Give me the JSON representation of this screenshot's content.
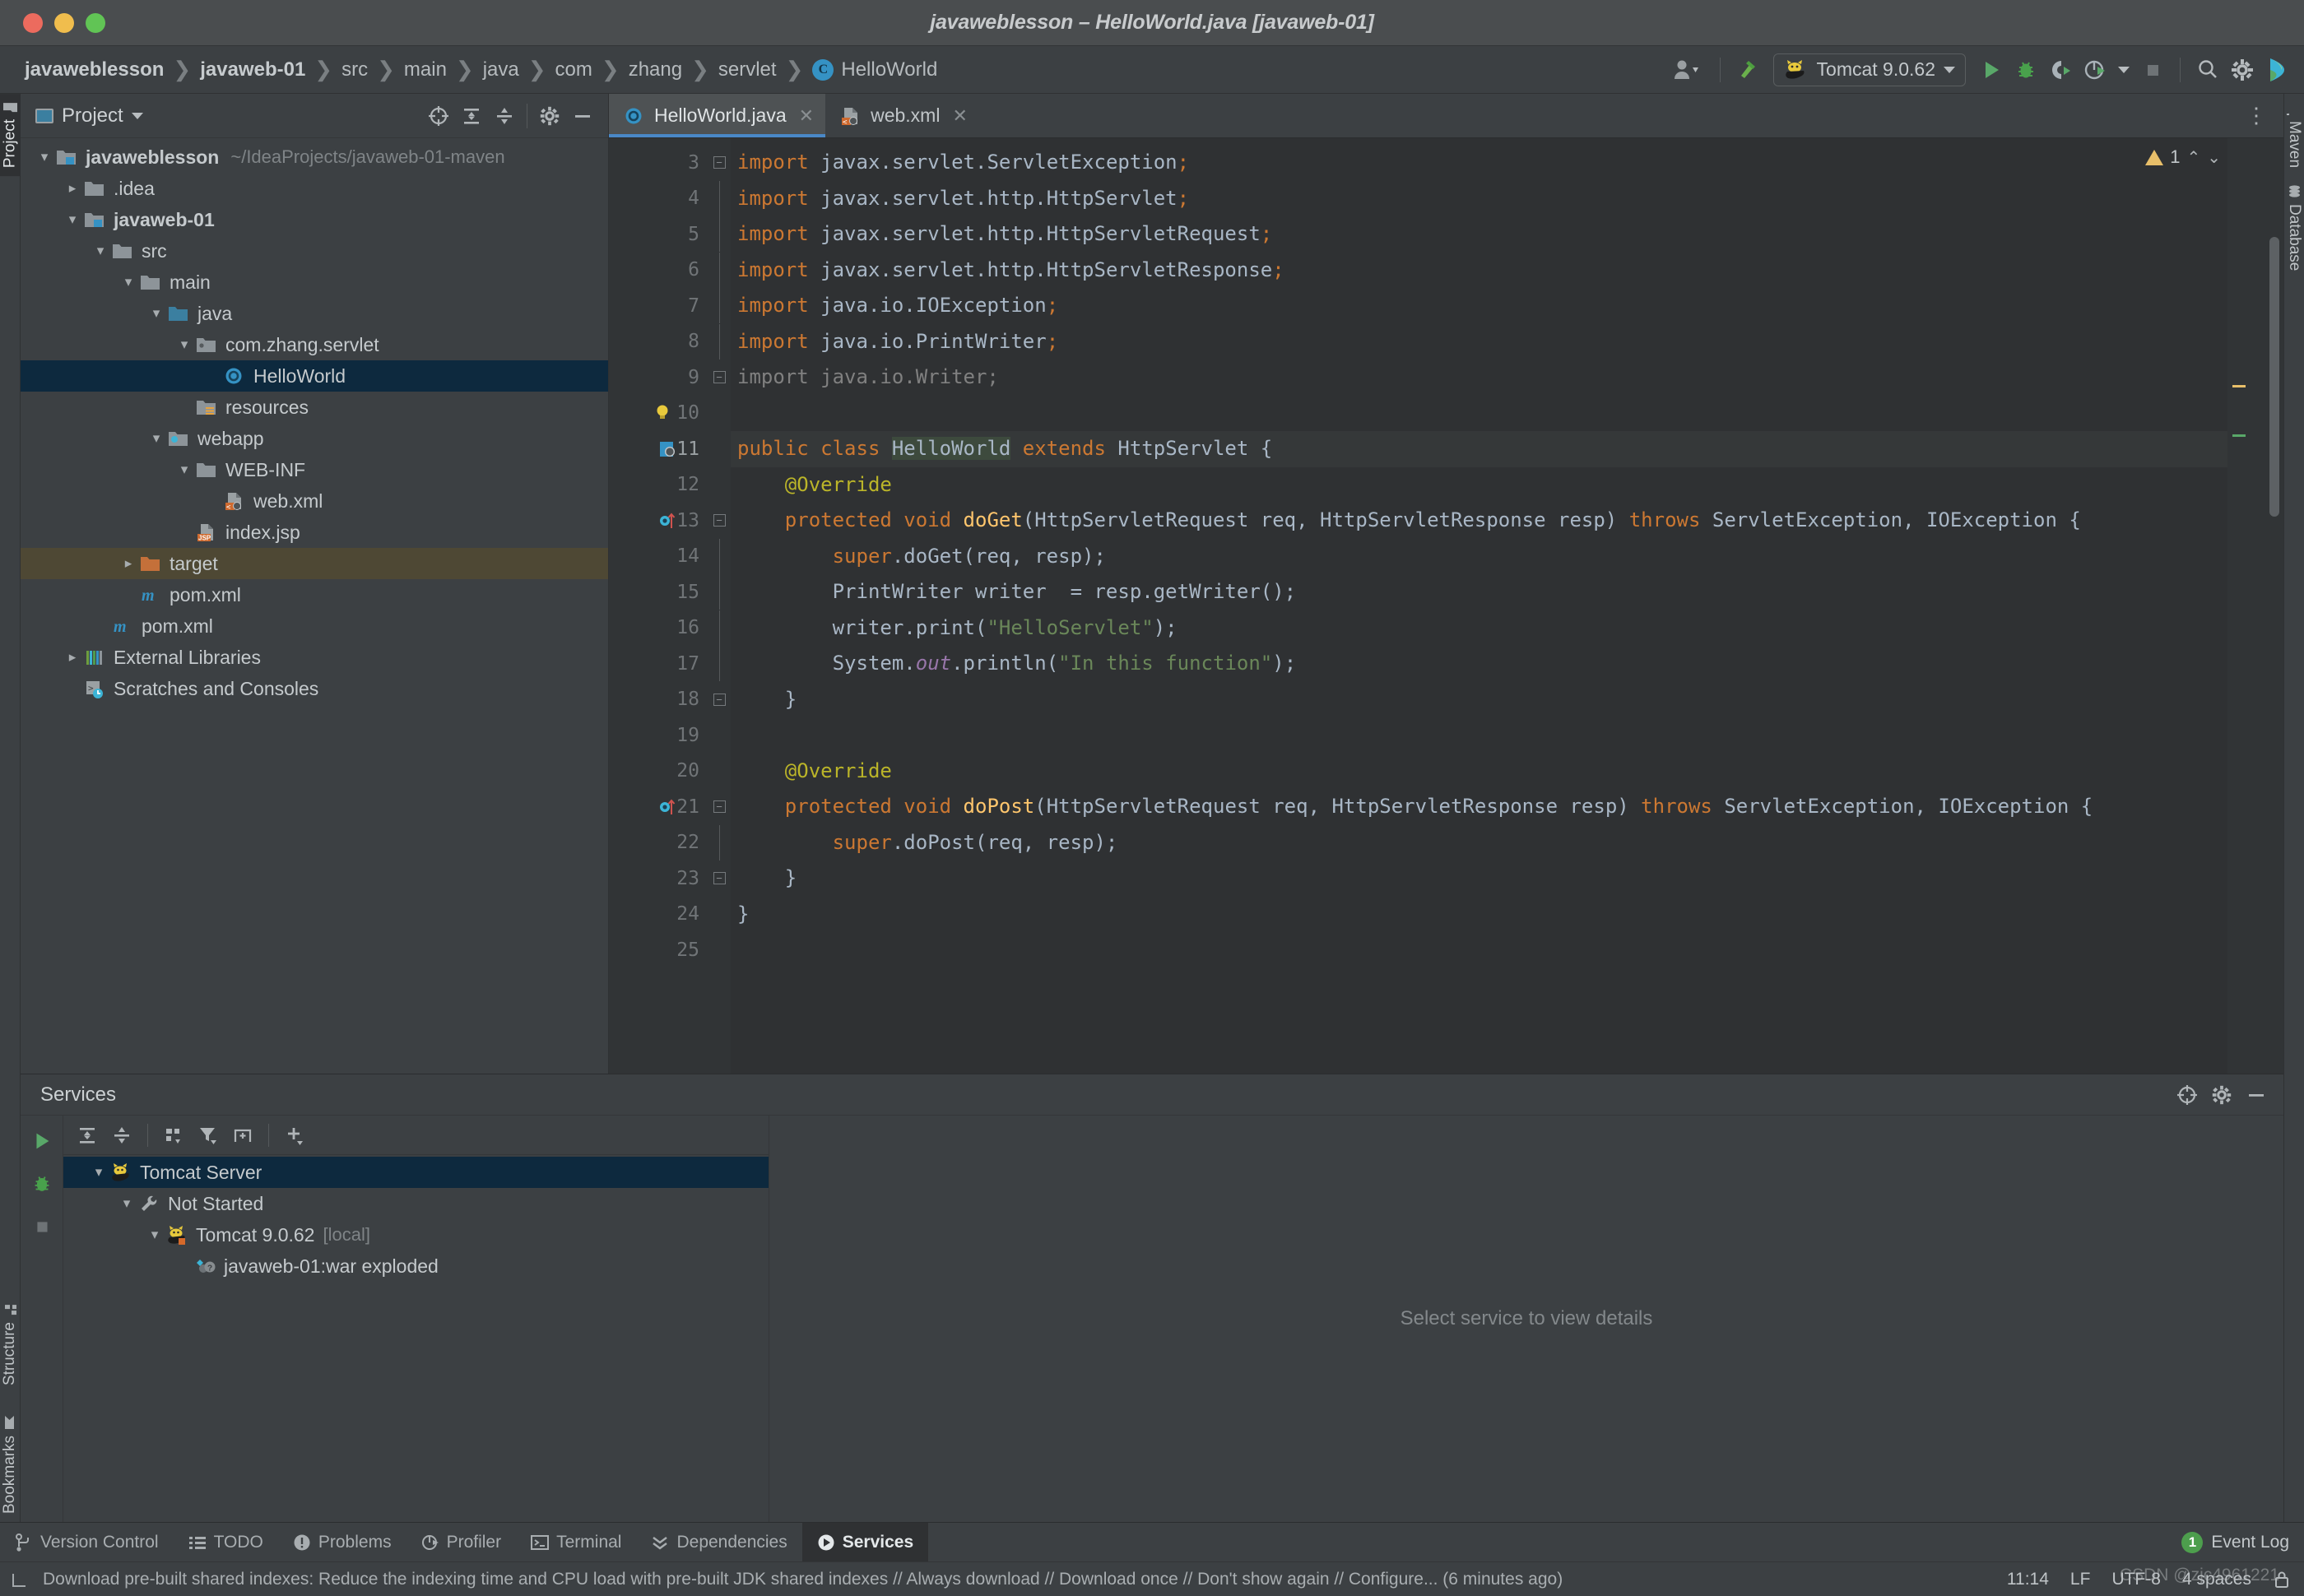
{
  "window": {
    "title": "javaweblesson – HelloWorld.java [javaweb-01]",
    "traffic": [
      "close-button",
      "minimize-button",
      "maximize-button"
    ]
  },
  "breadcrumbs": [
    {
      "label": "javaweblesson",
      "bold": true
    },
    {
      "label": "javaweb-01",
      "bold": true
    },
    {
      "label": "src",
      "bold": false
    },
    {
      "label": "main",
      "bold": false
    },
    {
      "label": "java",
      "bold": false
    },
    {
      "label": "com",
      "bold": false
    },
    {
      "label": "zhang",
      "bold": false
    },
    {
      "label": "servlet",
      "bold": false
    }
  ],
  "breadcrumb_class": {
    "badge": "C",
    "label": "HelloWorld"
  },
  "toolbar": {
    "account_icon": "user-icon",
    "build_icon": "hammer-icon",
    "run_config": {
      "label": "Tomcat 9.0.62",
      "icon": "tomcat-cat-icon"
    },
    "run_label": "Run",
    "debug_label": "Debug",
    "run_coverage_label": "Run with Coverage",
    "profiler_label": "Profiler",
    "stop_label": "Stop",
    "search_label": "Search Everywhere",
    "settings_label": "Settings",
    "updates_label": "Updates"
  },
  "left_tabs": [
    {
      "label": "Project",
      "icon": "folder-icon",
      "active": true
    }
  ],
  "left_tabs_bottom": [
    {
      "label": "Structure",
      "icon": "structure-icon",
      "active": false
    },
    {
      "label": "Bookmarks",
      "icon": "bookmark-icon",
      "active": false
    }
  ],
  "right_tabs": [
    {
      "label": "Maven",
      "icon": "maven-m-icon"
    },
    {
      "label": "Database",
      "icon": "database-icon"
    }
  ],
  "project_panel": {
    "title": "Project",
    "actions": [
      "locate-icon",
      "expand-all-icon",
      "collapse-all-icon",
      "gear-icon",
      "minimize-icon"
    ],
    "tree": [
      {
        "indent": 0,
        "chev": "down",
        "icon": "module-folder-icon",
        "label": "javaweblesson",
        "bold": true,
        "path": "~/IdeaProjects/javaweb-01-maven",
        "state": "none"
      },
      {
        "indent": 1,
        "chev": "right",
        "icon": "folder-icon",
        "label": ".idea",
        "bold": false,
        "path": "",
        "state": "none"
      },
      {
        "indent": 1,
        "chev": "down",
        "icon": "module-folder-icon",
        "label": "javaweb-01",
        "bold": true,
        "path": "",
        "state": "none"
      },
      {
        "indent": 2,
        "chev": "down",
        "icon": "folder-icon",
        "label": "src",
        "bold": false,
        "path": "",
        "state": "none"
      },
      {
        "indent": 3,
        "chev": "down",
        "icon": "folder-icon",
        "label": "main",
        "bold": false,
        "path": "",
        "state": "none"
      },
      {
        "indent": 4,
        "chev": "down",
        "icon": "source-folder-icon",
        "label": "java",
        "bold": false,
        "path": "",
        "state": "none"
      },
      {
        "indent": 5,
        "chev": "down",
        "icon": "package-icon",
        "label": "com.zhang.servlet",
        "bold": false,
        "path": "",
        "state": "none"
      },
      {
        "indent": 6,
        "chev": "none",
        "icon": "java-class-icon",
        "label": "HelloWorld",
        "bold": false,
        "path": "",
        "state": "selected"
      },
      {
        "indent": 5,
        "chev": "none",
        "icon": "resources-folder-icon",
        "label": "resources",
        "bold": false,
        "path": "",
        "state": "none"
      },
      {
        "indent": 4,
        "chev": "down",
        "icon": "webapp-folder-icon",
        "label": "webapp",
        "bold": false,
        "path": "",
        "state": "none"
      },
      {
        "indent": 5,
        "chev": "down",
        "icon": "folder-icon",
        "label": "WEB-INF",
        "bold": false,
        "path": "",
        "state": "none"
      },
      {
        "indent": 6,
        "chev": "none",
        "icon": "xml-file-icon",
        "label": "web.xml",
        "bold": false,
        "path": "",
        "state": "none"
      },
      {
        "indent": 5,
        "chev": "none",
        "icon": "jsp-file-icon",
        "label": "index.jsp",
        "bold": false,
        "path": "",
        "state": "none"
      },
      {
        "indent": 3,
        "chev": "right",
        "icon": "excluded-folder-icon",
        "label": "target",
        "bold": false,
        "path": "",
        "state": "highlight"
      },
      {
        "indent": 3,
        "chev": "none",
        "icon": "maven-m-icon",
        "label": "pom.xml",
        "bold": false,
        "path": "",
        "state": "none"
      },
      {
        "indent": 2,
        "chev": "none",
        "icon": "maven-m-icon",
        "label": "pom.xml",
        "bold": false,
        "path": "",
        "state": "none"
      },
      {
        "indent": 1,
        "chev": "right",
        "icon": "libraries-icon",
        "label": "External Libraries",
        "bold": false,
        "path": "",
        "state": "none"
      },
      {
        "indent": 1,
        "chev": "none",
        "icon": "scratches-icon",
        "label": "Scratches and Consoles",
        "bold": false,
        "path": "",
        "state": "none"
      }
    ]
  },
  "editor": {
    "tabs": [
      {
        "label": "HelloWorld.java",
        "icon": "java-class-icon",
        "active": true
      },
      {
        "label": "web.xml",
        "icon": "xml-file-icon",
        "active": false
      }
    ],
    "warning_count": "1",
    "first_line_number": 3,
    "code_lines": [
      {
        "n": 3,
        "fold": "minus-top",
        "bulb": false,
        "gmark": "",
        "current": false,
        "tokens": [
          {
            "t": "import ",
            "c": "k"
          },
          {
            "t": "javax.servlet.ServletException",
            "c": "id"
          },
          {
            "t": ";",
            "c": "k"
          }
        ]
      },
      {
        "n": 4,
        "fold": "line",
        "bulb": false,
        "gmark": "",
        "current": false,
        "tokens": [
          {
            "t": "import ",
            "c": "k"
          },
          {
            "t": "javax.servlet.http.HttpServlet",
            "c": "id"
          },
          {
            "t": ";",
            "c": "k"
          }
        ]
      },
      {
        "n": 5,
        "fold": "line",
        "bulb": false,
        "gmark": "",
        "current": false,
        "tokens": [
          {
            "t": "import ",
            "c": "k"
          },
          {
            "t": "javax.servlet.http.HttpServletRequest",
            "c": "id"
          },
          {
            "t": ";",
            "c": "k"
          }
        ]
      },
      {
        "n": 6,
        "fold": "line",
        "bulb": false,
        "gmark": "",
        "current": false,
        "tokens": [
          {
            "t": "import ",
            "c": "k"
          },
          {
            "t": "javax.servlet.http.HttpServletResponse",
            "c": "id"
          },
          {
            "t": ";",
            "c": "k"
          }
        ]
      },
      {
        "n": 7,
        "fold": "line",
        "bulb": false,
        "gmark": "",
        "current": false,
        "tokens": [
          {
            "t": "import ",
            "c": "k"
          },
          {
            "t": "java.io.IOException",
            "c": "id"
          },
          {
            "t": ";",
            "c": "k"
          }
        ]
      },
      {
        "n": 8,
        "fold": "line",
        "bulb": false,
        "gmark": "",
        "current": false,
        "tokens": [
          {
            "t": "import ",
            "c": "k"
          },
          {
            "t": "java.io.PrintWriter",
            "c": "id"
          },
          {
            "t": ";",
            "c": "k"
          }
        ]
      },
      {
        "n": 9,
        "fold": "minus-bot",
        "bulb": false,
        "gmark": "",
        "current": false,
        "tokens": [
          {
            "t": "import java.io.Writer;",
            "c": "dim"
          }
        ]
      },
      {
        "n": 10,
        "fold": "none",
        "bulb": true,
        "gmark": "",
        "current": false,
        "tokens": []
      },
      {
        "n": 11,
        "fold": "none",
        "bulb": false,
        "gmark": "web-marker-icon",
        "current": true,
        "tokens": [
          {
            "t": "public class ",
            "c": "k"
          },
          {
            "t": "HelloWorld",
            "c": "clsname"
          },
          {
            "t": " extends ",
            "c": "k"
          },
          {
            "t": "HttpServlet",
            "c": "id"
          },
          {
            "t": " {",
            "c": "id"
          }
        ]
      },
      {
        "n": 12,
        "fold": "none",
        "bulb": false,
        "gmark": "",
        "current": false,
        "tokens": [
          {
            "t": "    @Override",
            "c": "ann"
          }
        ]
      },
      {
        "n": 13,
        "fold": "minus-top",
        "bulb": false,
        "gmark": "override-icon",
        "current": false,
        "tokens": [
          {
            "t": "    protected void ",
            "c": "k"
          },
          {
            "t": "doGet",
            "c": "mth"
          },
          {
            "t": "(HttpServletRequest req, HttpServletResponse resp) ",
            "c": "id"
          },
          {
            "t": "throws ",
            "c": "k"
          },
          {
            "t": "ServletException, IOException {",
            "c": "id"
          }
        ]
      },
      {
        "n": 14,
        "fold": "line",
        "bulb": false,
        "gmark": "",
        "current": false,
        "tokens": [
          {
            "t": "        super",
            "c": "k"
          },
          {
            "t": ".doGet(req, resp);",
            "c": "id"
          }
        ]
      },
      {
        "n": 15,
        "fold": "line",
        "bulb": false,
        "gmark": "",
        "current": false,
        "tokens": [
          {
            "t": "        PrintWriter writer  = resp.getWriter();",
            "c": "id"
          }
        ]
      },
      {
        "n": 16,
        "fold": "line",
        "bulb": false,
        "gmark": "",
        "current": false,
        "tokens": [
          {
            "t": "        writer.print(",
            "c": "id"
          },
          {
            "t": "\"HelloServlet\"",
            "c": "str"
          },
          {
            "t": ");",
            "c": "id"
          }
        ]
      },
      {
        "n": 17,
        "fold": "line",
        "bulb": false,
        "gmark": "",
        "current": false,
        "tokens": [
          {
            "t": "        System.",
            "c": "id"
          },
          {
            "t": "out",
            "c": "fld"
          },
          {
            "t": ".println(",
            "c": "id"
          },
          {
            "t": "\"In this function\"",
            "c": "str"
          },
          {
            "t": ");",
            "c": "id"
          }
        ]
      },
      {
        "n": 18,
        "fold": "minus-bot",
        "bulb": false,
        "gmark": "",
        "current": false,
        "tokens": [
          {
            "t": "    }",
            "c": "id"
          }
        ]
      },
      {
        "n": 19,
        "fold": "none",
        "bulb": false,
        "gmark": "",
        "current": false,
        "tokens": []
      },
      {
        "n": 20,
        "fold": "none",
        "bulb": false,
        "gmark": "",
        "current": false,
        "tokens": [
          {
            "t": "    @Override",
            "c": "ann"
          }
        ]
      },
      {
        "n": 21,
        "fold": "minus-top",
        "bulb": false,
        "gmark": "override-icon",
        "current": false,
        "tokens": [
          {
            "t": "    protected void ",
            "c": "k"
          },
          {
            "t": "doPost",
            "c": "mth"
          },
          {
            "t": "(HttpServletRequest req, HttpServletResponse resp) ",
            "c": "id"
          },
          {
            "t": "throws ",
            "c": "k"
          },
          {
            "t": "ServletException, IOException {",
            "c": "id"
          }
        ]
      },
      {
        "n": 22,
        "fold": "line",
        "bulb": false,
        "gmark": "",
        "current": false,
        "tokens": [
          {
            "t": "        super",
            "c": "k"
          },
          {
            "t": ".doPost(req, resp);",
            "c": "id"
          }
        ]
      },
      {
        "n": 23,
        "fold": "minus-bot",
        "bulb": false,
        "gmark": "",
        "current": false,
        "tokens": [
          {
            "t": "    }",
            "c": "id"
          }
        ]
      },
      {
        "n": 24,
        "fold": "none",
        "bulb": false,
        "gmark": "",
        "current": false,
        "tokens": [
          {
            "t": "}",
            "c": "id"
          }
        ]
      },
      {
        "n": 25,
        "fold": "none",
        "bulb": false,
        "gmark": "",
        "current": false,
        "tokens": []
      }
    ]
  },
  "services": {
    "title": "Services",
    "header_actions": [
      "locate-icon",
      "gear-icon",
      "minimize-icon"
    ],
    "run_strip": [
      "run-icon",
      "debug-icon",
      "stop-icon"
    ],
    "toolbar": [
      "expand-all-icon",
      "collapse-all-icon",
      "group-by-icon",
      "filter-icon",
      "add-tab-icon",
      "add-icon"
    ],
    "tree": [
      {
        "indent": 0,
        "chev": "down",
        "icon": "tomcat-cat-icon",
        "label": "Tomcat Server",
        "suffix": "",
        "state": "selected"
      },
      {
        "indent": 1,
        "chev": "down",
        "icon": "wrench-icon",
        "label": "Not Started",
        "suffix": "",
        "state": "none"
      },
      {
        "indent": 2,
        "chev": "down",
        "icon": "tomcat-cat-stopped-icon",
        "label": "Tomcat 9.0.62",
        "suffix": "[local]",
        "state": "none"
      },
      {
        "indent": 3,
        "chev": "none",
        "icon": "artifact-war-icon",
        "label": "javaweb-01:war exploded",
        "suffix": "",
        "state": "none"
      }
    ],
    "empty_message": "Select service to view details"
  },
  "bottom_tabs": [
    {
      "label": "Version Control",
      "icon": "branch-icon",
      "active": false
    },
    {
      "label": "TODO",
      "icon": "list-icon",
      "active": false
    },
    {
      "label": "Problems",
      "icon": "error-icon",
      "active": false
    },
    {
      "label": "Profiler",
      "icon": "profiler-icon",
      "active": false
    },
    {
      "label": "Terminal",
      "icon": "terminal-icon",
      "active": false
    },
    {
      "label": "Dependencies",
      "icon": "dependencies-icon",
      "active": false
    },
    {
      "label": "Services",
      "icon": "services-icon",
      "active": true
    }
  ],
  "event_log": {
    "count": "1",
    "label": "Event Log"
  },
  "status_bar": {
    "message": "Download pre-built shared indexes: Reduce the indexing time and CPU load with pre-built JDK shared indexes // Always download // Download once // Don't show again // Configure... (6 minutes ago)",
    "time": "11:14",
    "line_sep": "LF",
    "encoding": "UTF-8",
    "indent": "4 spaces",
    "lock_icon": "lock-icon",
    "watermark": "CSDN @zjc4961221"
  },
  "colors": {
    "accent_blue": "#4a88c7",
    "selection_blue": "#0d293e",
    "keyword_orange": "#cc7832",
    "string_green": "#6a8759",
    "annotation_yellow": "#bbb529",
    "method_yellow": "#ffc66d",
    "field_purple": "#9876aa",
    "identifier": "#a9b7c6",
    "warning_yellow": "#e8bf6a",
    "run_green": "#59a869",
    "target_orange": "#c4703a"
  }
}
